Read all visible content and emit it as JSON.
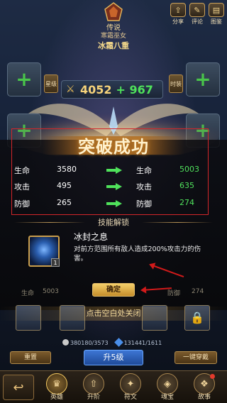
{
  "hero": {
    "rank": "传说",
    "title": "寒霜巫女",
    "name": "冰霜八重"
  },
  "top_buttons": [
    {
      "label": "分享",
      "icon": "share-icon"
    },
    {
      "label": "评论",
      "icon": "comment-icon"
    },
    {
      "label": "图鉴",
      "icon": "book-icon"
    }
  ],
  "power": {
    "value": "4052",
    "gain": "+ 967",
    "left_chip": "星级",
    "right_chip": "时装"
  },
  "breakthrough": {
    "title": "突破成功",
    "rows": [
      {
        "left_label": "生命",
        "before": "3580",
        "right_label": "生命",
        "after": "5003"
      },
      {
        "left_label": "攻击",
        "before": "495",
        "right_label": "攻击",
        "after": "635"
      },
      {
        "left_label": "防御",
        "before": "265",
        "right_label": "防御",
        "after": "274"
      }
    ]
  },
  "skill_unlock": {
    "heading": "技能解锁",
    "skill_name": "冰封之息",
    "skill_level": "1",
    "description": "对前方范围所有敌人造成200%攻击力的伤害。",
    "confirm_label": "确定"
  },
  "background_stats": {
    "hp_label": "生命",
    "hp_value": "5003",
    "def_label": "防御",
    "def_value": "274"
  },
  "close_hint": "点击空白处关闭",
  "resources": {
    "coins": "380180/3573",
    "gems": "131441/1611"
  },
  "action_buttons": {
    "left": "重置",
    "middle": "升5级",
    "right": "一键穿戴"
  },
  "tabs": [
    {
      "label": "英雄",
      "icon": "hero-icon",
      "active": true
    },
    {
      "label": "升阶",
      "icon": "upgrade-icon",
      "active": false
    },
    {
      "label": "符文",
      "icon": "rune-icon",
      "active": false
    },
    {
      "label": "魂宝",
      "icon": "soul-icon",
      "active": false
    },
    {
      "label": "故事",
      "icon": "story-icon",
      "active": false
    }
  ],
  "colors": {
    "accent_gold": "#f5d37a",
    "gain_green": "#50e15c",
    "annotation_red": "#d11a1a",
    "confirm_button": "#e0a944"
  }
}
